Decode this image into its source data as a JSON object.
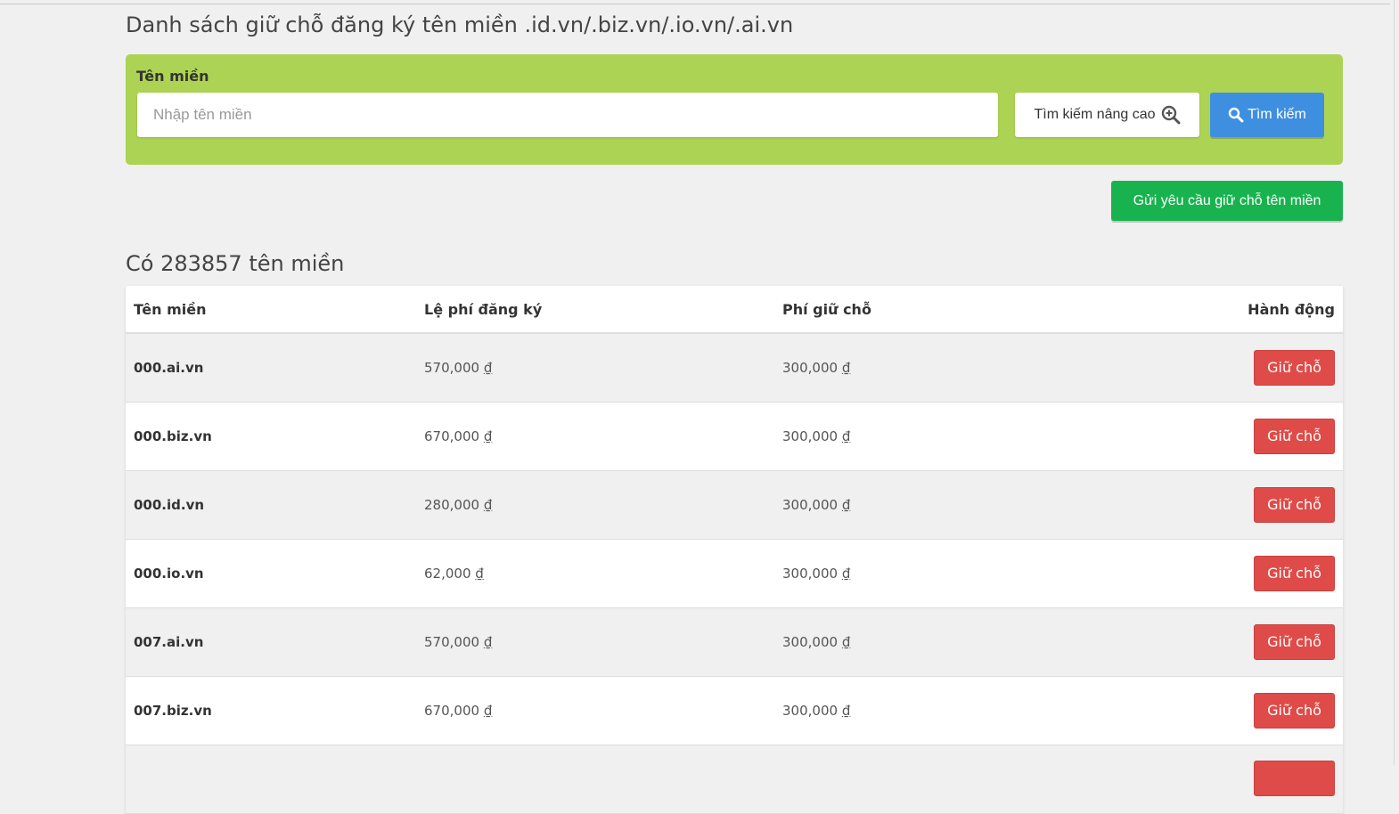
{
  "page": {
    "title": "Danh sách giữ chỗ đăng ký tên miền .id.vn/.biz.vn/.io.vn/.ai.vn"
  },
  "search": {
    "label": "Tên miền",
    "placeholder": "Nhập tên miền",
    "value": "",
    "advanced_label": "Tìm kiếm nâng cao",
    "advanced_icon": "zoom-in-icon",
    "submit_label": "Tìm kiếm",
    "submit_icon": "search-icon"
  },
  "request_button_label": "Gửi yêu cầu giữ chỗ tên miền",
  "results": {
    "count_text": "Có 283857 tên miền"
  },
  "table": {
    "headers": {
      "domain": "Tên miền",
      "registration_fee": "Lệ phí đăng ký",
      "hold_fee": "Phí giữ chỗ",
      "action": "Hành động"
    },
    "currency_symbol": "₫",
    "rows": [
      {
        "domain": "000.ai.vn",
        "registration_fee": "570,000",
        "hold_fee": "300,000",
        "action_label": "Giữ chỗ"
      },
      {
        "domain": "000.biz.vn",
        "registration_fee": "670,000",
        "hold_fee": "300,000",
        "action_label": "Giữ chỗ"
      },
      {
        "domain": "000.id.vn",
        "registration_fee": "280,000",
        "hold_fee": "300,000",
        "action_label": "Giữ chỗ"
      },
      {
        "domain": "000.io.vn",
        "registration_fee": "62,000",
        "hold_fee": "300,000",
        "action_label": "Giữ chỗ"
      },
      {
        "domain": "007.ai.vn",
        "registration_fee": "570,000",
        "hold_fee": "300,000",
        "action_label": "Giữ chỗ"
      },
      {
        "domain": "007.biz.vn",
        "registration_fee": "670,000",
        "hold_fee": "300,000",
        "action_label": "Giữ chỗ"
      },
      {
        "domain": "",
        "registration_fee": "",
        "hold_fee": "",
        "action_label": ""
      }
    ]
  },
  "colors": {
    "search_panel": "#acd353",
    "search_button": "#3f8fe0",
    "request_button": "#18b34f",
    "hold_button": "#df4b48",
    "page_background": "#f0f0f0"
  }
}
